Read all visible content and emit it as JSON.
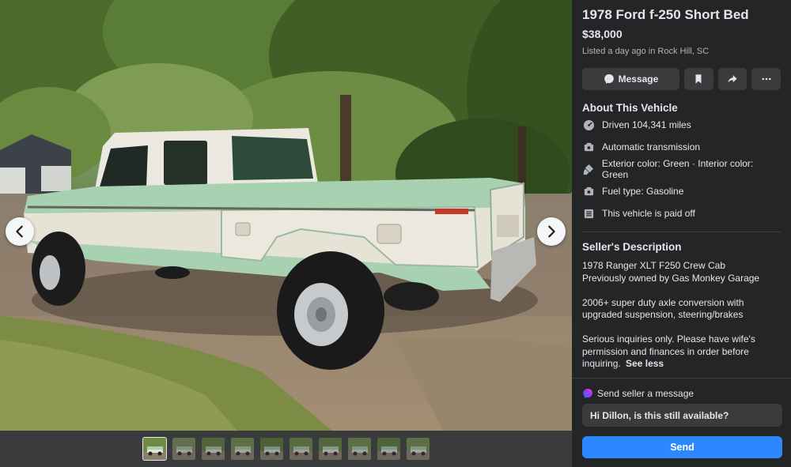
{
  "listing": {
    "title": "1978 Ford f-250 Short Bed",
    "price": "$38,000",
    "listed": "Listed a day ago in Rock Hill, SC"
  },
  "actions": {
    "message_label": "Message",
    "save_icon": "bookmark-icon",
    "share_icon": "share-icon",
    "more_icon": "more-icon",
    "message_icon": "messenger-icon"
  },
  "about": {
    "title": "About This Vehicle",
    "specs": [
      {
        "icon": "odometer-icon",
        "text": "Driven 104,341 miles"
      },
      {
        "icon": "transmission-icon",
        "text": "Automatic transmission"
      },
      {
        "icon": "paint-icon",
        "text": "Exterior color: Green · Interior color: Green"
      },
      {
        "icon": "fuel-icon",
        "text": "Fuel type: Gasoline"
      },
      {
        "icon": "document-icon",
        "text": "This vehicle is paid off"
      }
    ]
  },
  "seller_description": {
    "title": "Seller's Description",
    "line1": "1978 Ranger XLT F250 Crew Cab",
    "line2": "Previously owned by Gas Monkey Garage",
    "para2": "2006+ super duty axle conversion with upgraded suspension, steering/brakes",
    "para3": "Serious inquiries only. Please have wife's permission and finances in order before inquiring.",
    "see_less": "See less"
  },
  "send_message": {
    "header": "Send seller a message",
    "input_value": "Hi Dillon, is this still available?",
    "send_label": "Send"
  },
  "gallery": {
    "thumbnail_count": 10,
    "active_index": 0
  },
  "colors": {
    "panel_bg": "#242526",
    "button_bg": "#3a3b3c",
    "accent": "#2d88ff",
    "truck_green": "#a7d1b1",
    "truck_white": "#e6e2d6"
  }
}
